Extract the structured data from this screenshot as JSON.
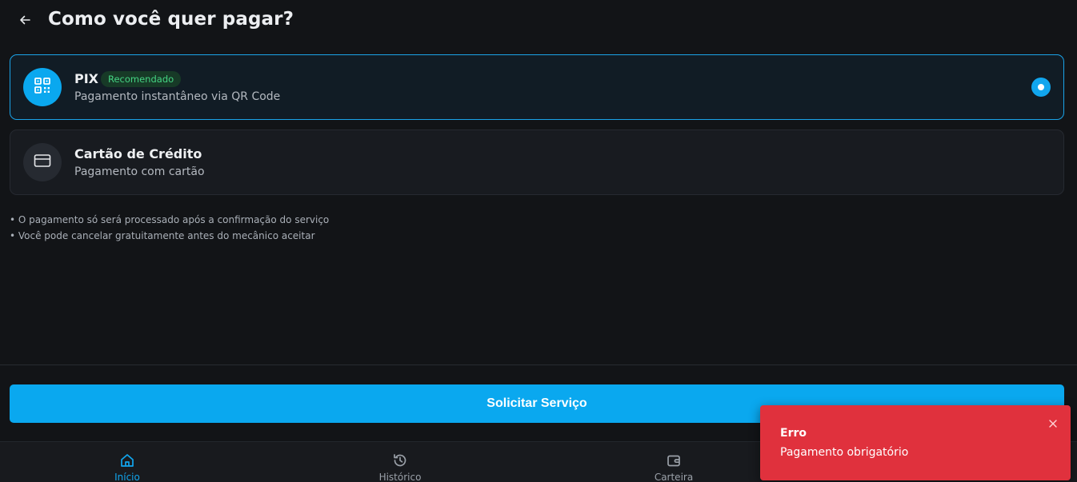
{
  "header": {
    "title": "Como você quer pagar?",
    "back_icon": "arrow-left-icon"
  },
  "payment_options": [
    {
      "title": "PIX",
      "badge": "Recomendado",
      "subtitle": "Pagamento instantâneo via QR Code",
      "icon": "qr-code-icon",
      "selected": true
    },
    {
      "title": "Cartão de Crédito",
      "subtitle": "Pagamento com cartão",
      "icon": "credit-card-icon",
      "selected": false
    }
  ],
  "notes": [
    "• O pagamento só será processado após a confirmação do serviço",
    "• Você pode cancelar gratuitamente antes do mecânico aceitar"
  ],
  "submit_button": {
    "label": "Solicitar Serviço"
  },
  "bottom_nav": {
    "items": [
      {
        "label": "Início",
        "icon": "home-icon",
        "active": true
      },
      {
        "label": "Histórico",
        "icon": "history-icon",
        "active": false
      },
      {
        "label": "Carteira",
        "icon": "wallet-icon",
        "active": false
      }
    ]
  },
  "toast": {
    "title": "Erro",
    "message": "Pagamento obrigatório",
    "close_icon": "close-icon"
  },
  "colors": {
    "accent": "#0aa8ef",
    "background": "#121417",
    "badge_text": "#45d483",
    "error": "#e0313d"
  }
}
